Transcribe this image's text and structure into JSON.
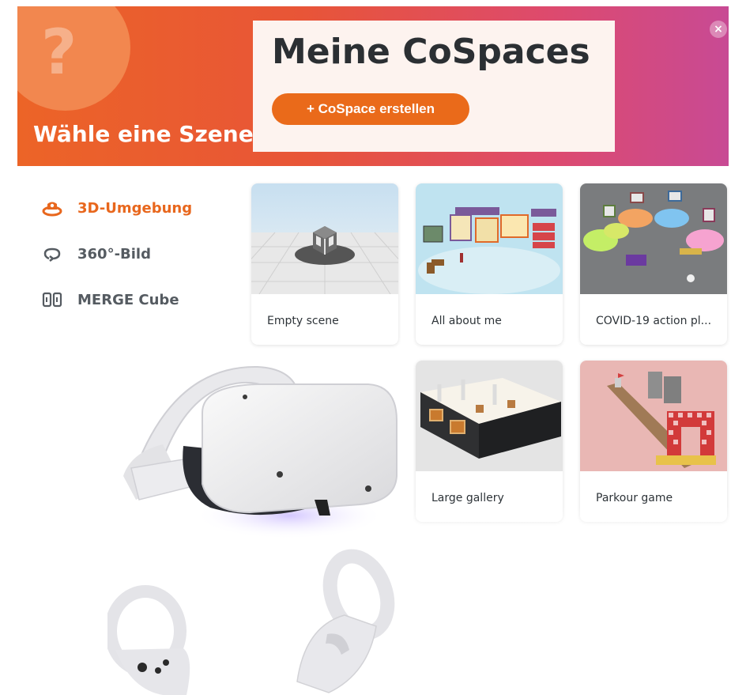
{
  "banner": {
    "icon": "question-mark-icon",
    "question_mark": "?",
    "subtitle": "Wähle eine Szene",
    "close_label": "×"
  },
  "panel": {
    "title": "Meine CoSpaces",
    "create_button": "+ CoSpace erstellen"
  },
  "sidebar": {
    "items": [
      {
        "label": "3D-Umgebung",
        "icon": "3d-environment-icon",
        "active": true
      },
      {
        "label": "360°-Bild",
        "icon": "360-rotate-icon",
        "active": false
      },
      {
        "label": "MERGE Cube",
        "icon": "merge-cube-icon",
        "active": false
      }
    ]
  },
  "cards": [
    {
      "label": "Empty scene"
    },
    {
      "label": "All about me"
    },
    {
      "label": "COVID-19 action pl..."
    },
    {
      "label": "Large gallery"
    },
    {
      "label": "Parkour game"
    }
  ],
  "colors": {
    "accent": "#ea6a1a",
    "banner_start": "#ec6427",
    "banner_end": "#c84a94",
    "active_text": "#e8671d"
  }
}
